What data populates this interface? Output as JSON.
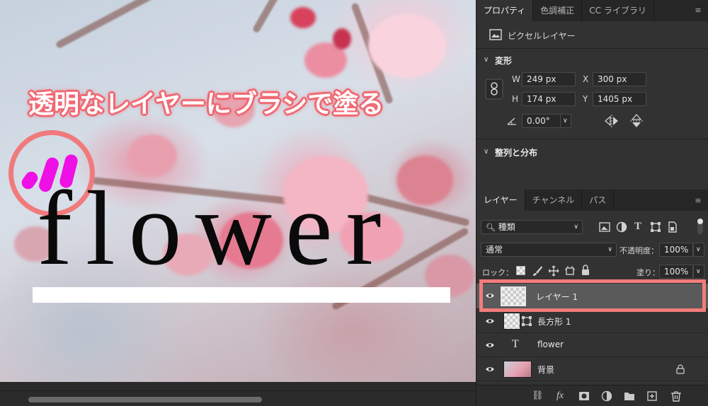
{
  "canvas": {
    "headline": "透明なレイヤーにブラシで塗る",
    "word": "flower"
  },
  "properties_panel": {
    "tabs": [
      "プロパティ",
      "色調補正",
      "CC ライブラリ"
    ],
    "active_tab": "プロパティ",
    "layer_kind": "ピクセルレイヤー",
    "transform": {
      "title": "変形",
      "w_label": "W",
      "w_value": "249 px",
      "h_label": "H",
      "h_value": "174 px",
      "x_label": "X",
      "x_value": "300 px",
      "y_label": "Y",
      "y_value": "1405 px",
      "angle_value": "0.00°"
    },
    "align": {
      "title": "整列と分布"
    }
  },
  "layers_panel": {
    "tabs": [
      "レイヤー",
      "チャンネル",
      "パス"
    ],
    "active_tab": "レイヤー",
    "filter_kind": "種類",
    "blend_mode": "通常",
    "opacity_label": "不透明度：",
    "opacity_value": "100%",
    "lock_label": "ロック：",
    "fill_label": "塗り：",
    "fill_value": "100%",
    "layers": [
      {
        "name": "レイヤー 1",
        "type": "pixel",
        "selected": true
      },
      {
        "name": "長方形 1",
        "type": "shape",
        "selected": false
      },
      {
        "name": "flower",
        "type": "text",
        "selected": false
      },
      {
        "name": "背景",
        "type": "background",
        "selected": false,
        "locked": true
      }
    ]
  },
  "colors": {
    "accent": "#f27c7c",
    "brush": "#ee10e5",
    "panel_bg": "#323232"
  }
}
